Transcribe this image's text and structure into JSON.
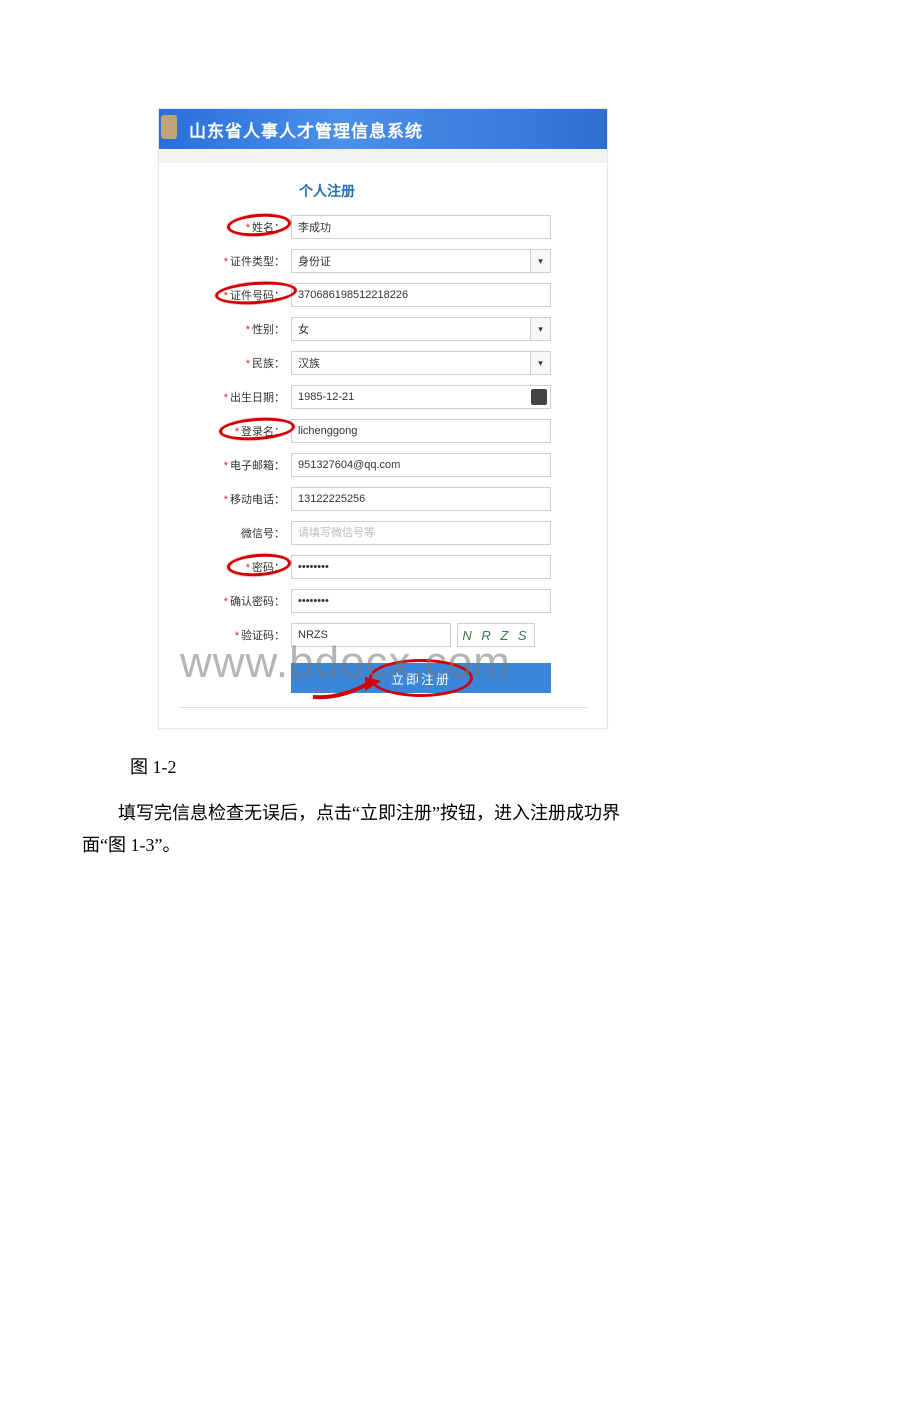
{
  "banner": {
    "title": "山东省人事人才管理信息系统"
  },
  "section": {
    "title": "个人注册"
  },
  "fields": {
    "name": {
      "label": "姓名：",
      "required": true,
      "value": "李成功",
      "highlighted": true
    },
    "id_type": {
      "label": "证件类型：",
      "required": true,
      "value": "身份证",
      "highlighted": false
    },
    "id_no": {
      "label": "证件号码：",
      "required": true,
      "value": "370686198512218226",
      "highlighted": true
    },
    "gender": {
      "label": "性别：",
      "required": true,
      "value": "女",
      "highlighted": false
    },
    "nation": {
      "label": "民族：",
      "required": true,
      "value": "汉族",
      "highlighted": false
    },
    "birth": {
      "label": "出生日期：",
      "required": true,
      "value": "1985-12-21",
      "highlighted": false
    },
    "login": {
      "label": "登录名：",
      "required": true,
      "value": "lichenggong",
      "highlighted": true
    },
    "email": {
      "label": "电子邮箱：",
      "required": true,
      "value": "951327604@qq.com",
      "highlighted": false
    },
    "mobile": {
      "label": "移动电话：",
      "required": true,
      "value": "13122225256",
      "highlighted": false
    },
    "wechat": {
      "label": "微信号：",
      "required": false,
      "value": "",
      "placeholder": "请填写微信号等",
      "highlighted": false
    },
    "password": {
      "label": "密码：",
      "required": true,
      "value": "********",
      "highlighted": true
    },
    "password2": {
      "label": "确认密码：",
      "required": true,
      "value": "********",
      "highlighted": false
    },
    "captcha": {
      "label": "验证码：",
      "required": true,
      "value": "NRZS",
      "image_text": "N R Z S"
    }
  },
  "submit": {
    "label": "立即注册"
  },
  "watermark": "www.bdocx.com",
  "caption": "图 1-2",
  "body": {
    "line1": "填写完信息检查无误后，点击“立即注册”按钮，进入注册成功界",
    "line2": "面“图 1-3”。"
  }
}
